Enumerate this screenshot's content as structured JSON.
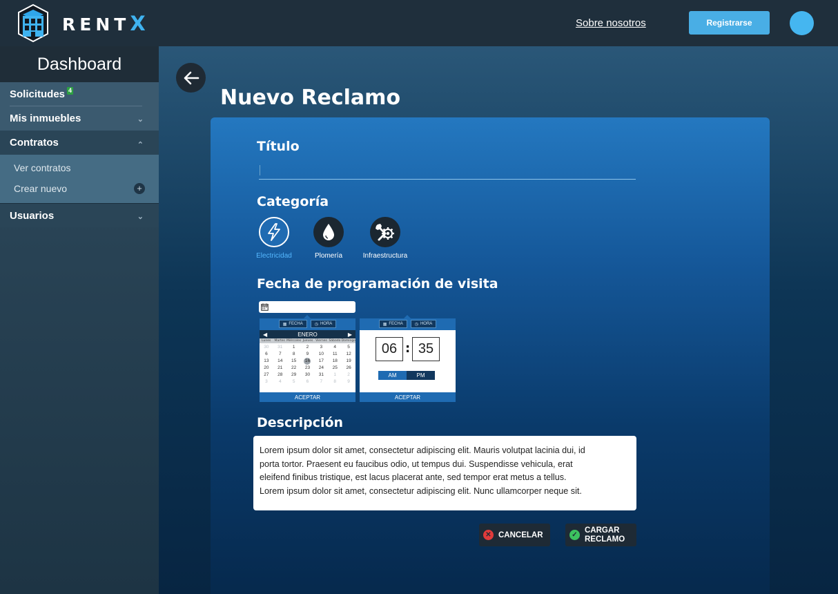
{
  "header": {
    "brand_text": "RENT",
    "brand_accent": "X",
    "about_link": "Sobre nosotros",
    "register_label": "Registrarse"
  },
  "sidebar": {
    "title": "Dashboard",
    "items": [
      {
        "label": "Solicitudes",
        "badge": "4"
      },
      {
        "label": "Mis inmuebles"
      },
      {
        "label": "Contratos"
      },
      {
        "label": "Usuarios"
      }
    ],
    "contracts_submenu": [
      {
        "label": "Ver contratos"
      },
      {
        "label": "Crear nuevo"
      }
    ]
  },
  "main": {
    "page_title": "Nuevo Reclamo",
    "form": {
      "title_label": "Título",
      "title_value": "",
      "category_label": "Categoría",
      "categories": [
        {
          "label": "Electricidad",
          "icon": "lightning-icon",
          "selected": true
        },
        {
          "label": "Plomería",
          "icon": "water-drop-icon",
          "selected": false
        },
        {
          "label": "Infraestructura",
          "icon": "wrench-gear-icon",
          "selected": false
        }
      ],
      "date_label": "Fecha de programación de visita",
      "date_value": "",
      "date_picker": {
        "tab_date": "FECHA",
        "tab_time": "HORA",
        "month": "ENERO",
        "weekdays": [
          "Lunes",
          "Martes",
          "Miércoles",
          "Jueves",
          "Viernes",
          "Sábado",
          "Domingo"
        ],
        "weeks": [
          [
            "30",
            "31",
            "1",
            "2",
            "3",
            "4",
            "5"
          ],
          [
            "6",
            "7",
            "8",
            "9",
            "10",
            "11",
            "12"
          ],
          [
            "13",
            "14",
            "15",
            "16",
            "17",
            "18",
            "19"
          ],
          [
            "20",
            "21",
            "22",
            "23",
            "24",
            "25",
            "26"
          ],
          [
            "27",
            "28",
            "29",
            "30",
            "31",
            "1",
            "2"
          ],
          [
            "3",
            "4",
            "5",
            "6",
            "7",
            "8",
            "9"
          ]
        ],
        "selected_day": "16",
        "accept": "ACEPTAR"
      },
      "time_picker": {
        "tab_date": "FECHA",
        "tab_time": "HORA",
        "hour": "06",
        "minute": "35",
        "am": "AM",
        "pm": "PM",
        "accept": "ACEPTAR"
      },
      "description_label": "Descripción",
      "description_lines": [
        "Lorem ipsum dolor sit amet, consectetur adipiscing elit. Mauris volutpat lacinia dui, id",
        "porta tortor. Praesent eu faucibus odio, ut tempus dui. Suspendisse vehicula, erat",
        "eleifend finibus tristique, est lacus placerat ante, sed tempor erat metus a tellus.",
        "Lorem ipsum dolor sit amet, consectetur adipiscing elit. Nunc ullamcorper neque sit."
      ],
      "cancel_label": "CANCELAR",
      "submit_label_1": "CARGAR",
      "submit_label_2": "RECLAMO"
    }
  },
  "colors": {
    "accent": "#49aee5",
    "brand_x": "#3fb3f0",
    "badge": "#2ea043",
    "cancel_icon": "#e03b3b",
    "submit_icon": "#3cc15f"
  }
}
